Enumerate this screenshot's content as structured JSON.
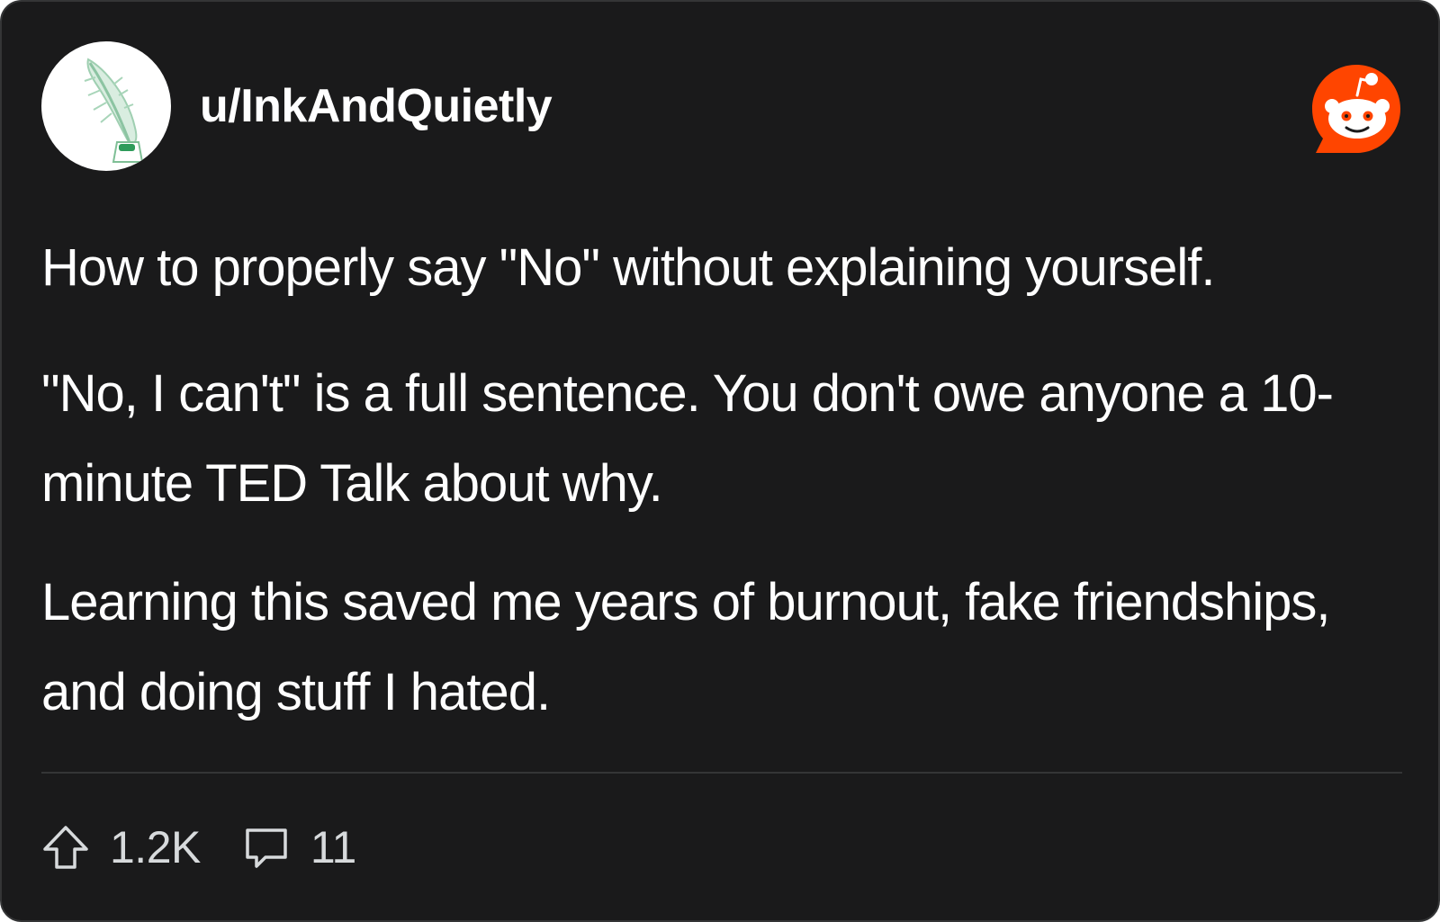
{
  "post": {
    "username": "u/InkAndQuietly",
    "paragraphs": [
      "How to properly say \"No\" without explaining yourself.",
      "\"No, I can't\" is a full sentence. You don't owe anyone a 10-minute TED Talk about why.",
      "Learning this saved me years of burnout, fake friendships, and doing stuff I hated."
    ]
  },
  "footer": {
    "upvotes": "1.2K",
    "comments": "11"
  },
  "icons": {
    "avatar": "quill-inkwell-avatar",
    "logo": "reddit-logo-icon",
    "upvote": "upvote-arrow-icon",
    "comment": "comment-bubble-icon"
  },
  "colors": {
    "background": "#1a1a1b",
    "text": "#ffffff",
    "muted_text": "#d7dadc",
    "divider": "#343536",
    "reddit_orange": "#ff4500",
    "avatar_bg": "#ffffff",
    "quill": "#b9dcc5",
    "inkwell": "#2e9b5a"
  }
}
